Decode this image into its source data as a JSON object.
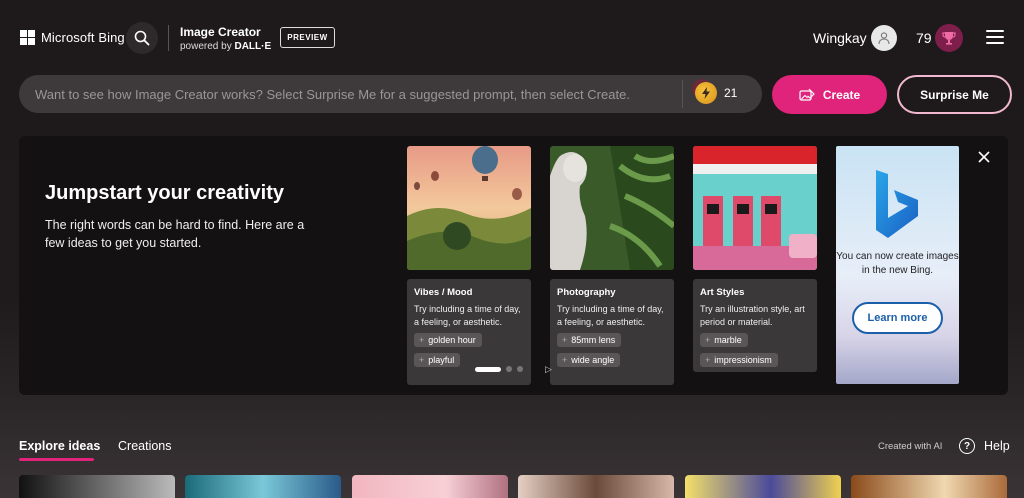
{
  "header": {
    "brand": "Microsoft Bing",
    "product_title": "Image Creator",
    "product_subtitle_prefix": "powered by ",
    "product_subtitle_brand": "DALL·E",
    "preview_badge": "PREVIEW",
    "user_name": "Wingkay",
    "coins": "79",
    "icons": {
      "search": "search-icon",
      "avatar": "user-avatar-icon",
      "reward": "rewards-trophy-icon",
      "menu": "hamburger-menu-icon"
    }
  },
  "prompt": {
    "placeholder": "Want to see how Image Creator works? Select Surprise Me for a suggested prompt, then select Create.",
    "boosts": "21",
    "create_label": "Create",
    "surprise_label": "Surprise Me"
  },
  "jumpstart": {
    "title": "Jumpstart your creativity",
    "description": "The right words can be hard to find. Here are a few ideas to get you started.",
    "cards": [
      {
        "title": "Vibes / Mood",
        "description": "Try including a time of day, a feeling, or aesthetic.",
        "chips": [
          "golden hour",
          "playful"
        ]
      },
      {
        "title": "Photography",
        "description": "Try including a time of day, a feeling, or aesthetic.",
        "chips": [
          "85mm lens",
          "wide angle"
        ]
      },
      {
        "title": "Art Styles",
        "description": "Try an illustration style, art period or material.",
        "chips": [
          "marble",
          "impressionism"
        ]
      }
    ],
    "ad": {
      "text": "You can now create images in the new Bing.",
      "button": "Learn more"
    }
  },
  "tabs": {
    "explore": "Explore ideas",
    "creations": "Creations",
    "created_with_ai": "Created with AI",
    "help": "Help"
  },
  "colors": {
    "accent": "#e0237b",
    "background": "#1e1a1b",
    "panel": "#141112",
    "learn_more": "#1b5faa"
  }
}
